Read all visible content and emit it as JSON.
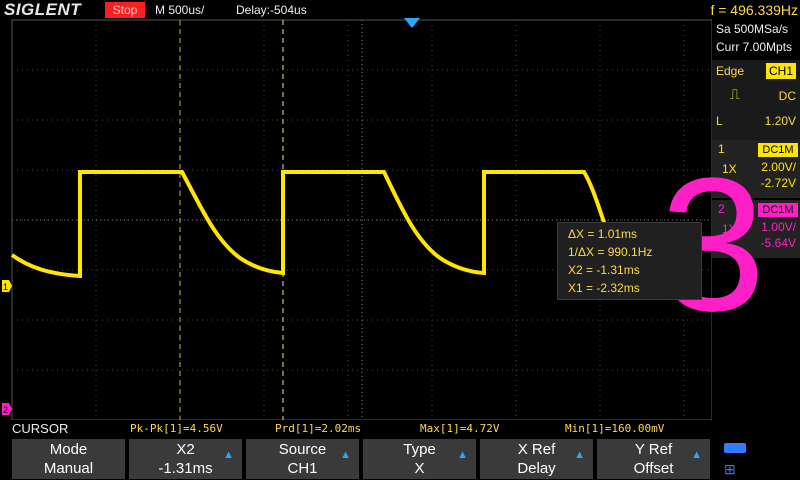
{
  "top": {
    "brand": "SIGLENT",
    "status": "Stop",
    "timebase": "M 500us/",
    "delay": "Delay:-504us",
    "frequency": "f = 496.339Hz"
  },
  "acq": {
    "sample_rate": "Sa 500MSa/s",
    "memory": "Curr 7.00Mpts"
  },
  "trigger": {
    "type": "Edge",
    "source": "CH1",
    "coupling": "DC",
    "level_label": "L",
    "level": "1.20V"
  },
  "channels": [
    {
      "num": "1",
      "coupling": "DC1M",
      "probe": "1X",
      "scale": "2.00V/",
      "offset": "-2.72V",
      "color": "#ffe600"
    },
    {
      "num": "2",
      "coupling": "DC1M",
      "probe": "1X",
      "scale": "1.00V/",
      "offset": "-5.64V",
      "color": "#ff1fc7"
    }
  ],
  "cursor_readout": {
    "dx": "ΔX = 1.01ms",
    "inv_dx": "1/ΔX = 990.1Hz",
    "x2": "X2 = -1.31ms",
    "x1": "X1 = -2.32ms"
  },
  "overlay": {
    "digit": "3"
  },
  "measurements": {
    "mode": "CURSOR",
    "pkpk": "Pk-Pk[1]=4.56V",
    "prd": "Prd[1]=2.02ms",
    "max": "Max[1]=4.72V",
    "min": "Min[1]=160.00mV"
  },
  "menu": [
    {
      "line1": "Mode",
      "line2": "Manual"
    },
    {
      "line1": "X2",
      "line2": "-1.31ms"
    },
    {
      "line1": "Source",
      "line2": "CH1"
    },
    {
      "line1": "Type",
      "line2": "X"
    },
    {
      "line1": "X Ref",
      "line2": "Delay"
    },
    {
      "line1": "Y Ref",
      "line2": "Offset"
    }
  ],
  "colors": {
    "ch1": "#ffe600",
    "ch2": "#ff1fc7",
    "accent": "#2ea8ff"
  },
  "icons": [
    "trigger-position-icon",
    "ch1-marker-icon",
    "ch2-marker-icon",
    "battery-icon",
    "network-icon"
  ]
}
